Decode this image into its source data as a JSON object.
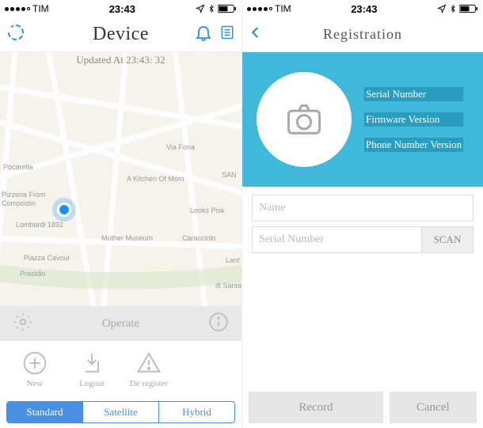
{
  "left": {
    "status": {
      "carrier": "TIM",
      "time": "23:43"
    },
    "header": {
      "title": "Device"
    },
    "map": {
      "updated": "Updated At 23:43: 32",
      "labels": {
        "pocarella": "Pocarella",
        "pizzeria": "Pizzeria From",
        "compostin": "Compostin",
        "lombardi": "Lombardi 1892",
        "mother": "Mother Museum",
        "kitchen": "A Kitchen Of Mom",
        "looks": "Looks Pisk",
        "foria": "Via Foria",
        "san": "SAN",
        "caracciolo": "Caracciolo",
        "piazza": "Piazza Cavour",
        "presidio": "Presidio",
        "lanf": "Lanf",
        "santa": "di Santa"
      }
    },
    "operate": {
      "label": "Operate"
    },
    "actions": {
      "new": "New",
      "logout": "Logout",
      "deregister": "De register"
    },
    "seg": {
      "standard": "Standard",
      "satellite": "Satellite",
      "hybrid": "Hybrid"
    }
  },
  "right": {
    "status": {
      "carrier": "TIM",
      "time": "23:43"
    },
    "header": {
      "title": "Registration"
    },
    "banner": {
      "serial_label": "Serial Number",
      "firmware_label": "Firmware Version",
      "phone_label": "Phone Number Version"
    },
    "form": {
      "name_placeholder": "Name",
      "serial_placeholder": "Serial Number",
      "scan_label": "SCAN"
    },
    "buttons": {
      "record": "Record",
      "cancel": "Cancel"
    }
  }
}
